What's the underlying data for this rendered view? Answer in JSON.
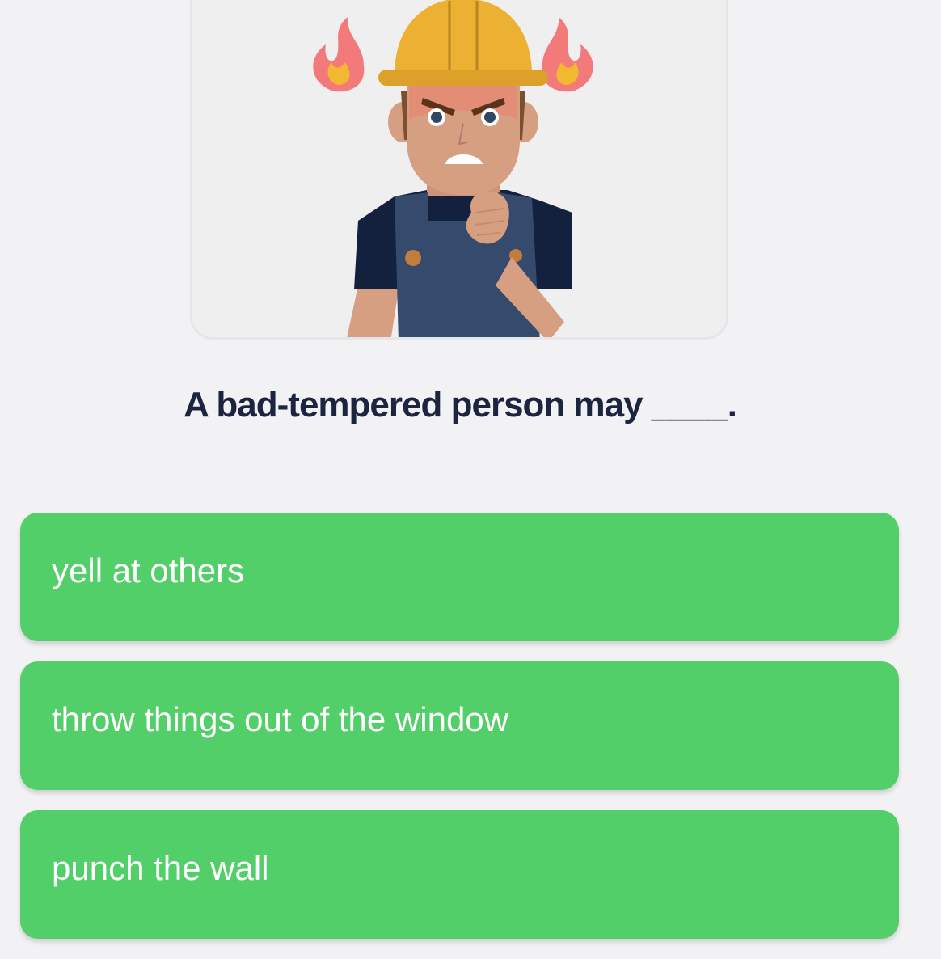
{
  "question": {
    "text": "A bad-tempered person may ____."
  },
  "illustration": {
    "icon": "angry-worker-illustration",
    "colors": {
      "helmet": "#ecb032",
      "flame": "#f27a7a",
      "flame_inner": "#f2b830",
      "skin": "#d79f82",
      "shirt": "#13213f",
      "overalls": "#354a6c"
    }
  },
  "options": [
    {
      "label": "yell at others"
    },
    {
      "label": "throw things out of the window"
    },
    {
      "label": "punch the wall"
    }
  ],
  "colors": {
    "background": "#f2f2f4",
    "option_bg": "#53cf6a",
    "question_text": "#1c2440"
  }
}
